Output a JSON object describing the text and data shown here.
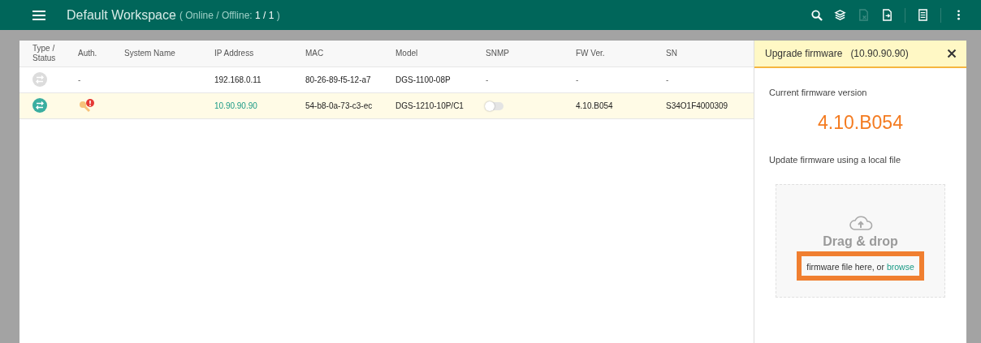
{
  "app_bar": {
    "title": "Default Workspace",
    "status_label": "( Online / Offline: ",
    "status_value": "1 / 1",
    "status_end": ")",
    "tools": [
      {
        "kind": "search",
        "disabled": false
      },
      {
        "kind": "stack",
        "disabled": false
      },
      {
        "kind": "file-x",
        "disabled": true
      },
      {
        "kind": "file-export",
        "disabled": false
      },
      {
        "kind": "sep"
      },
      {
        "kind": "list",
        "disabled": false
      },
      {
        "kind": "sep"
      },
      {
        "kind": "more",
        "disabled": false
      }
    ]
  },
  "table": {
    "columns": [
      "Type / Status",
      "Auth.",
      "System Name",
      "IP Address",
      "MAC",
      "Model",
      "SNMP",
      "FW Ver.",
      "SN"
    ],
    "rows": [
      {
        "online": false,
        "selected": false,
        "auth": {
          "kind": "text",
          "text": "-"
        },
        "system_name": "",
        "ip": "192.168.0.11",
        "mac": "80-26-89-f5-12-a7",
        "model": "DGS-1100-08P",
        "snmp": {
          "kind": "text",
          "text": "-"
        },
        "fw": "-",
        "sn": "-"
      },
      {
        "online": true,
        "selected": true,
        "auth": {
          "kind": "key-alert"
        },
        "system_name": "",
        "ip": "10.90.90.90",
        "mac": "54-b8-0a-73-c3-ec",
        "model": "DGS-1210-10P/C1",
        "snmp": {
          "kind": "toggle",
          "on": false
        },
        "fw": "4.10.B054",
        "sn": "S34O1F4000309"
      }
    ]
  },
  "panel": {
    "title": "Upgrade firmware",
    "subtitle": "(10.90.90.90)",
    "current_label": "Current firmware version",
    "current_version": "4.10.B054",
    "update_label": "Update firmware using a local file",
    "drop_zone": {
      "title": "Drag & drop",
      "hint": "firmware file here, or ",
      "link": "browse",
      "highlighted": true
    }
  }
}
